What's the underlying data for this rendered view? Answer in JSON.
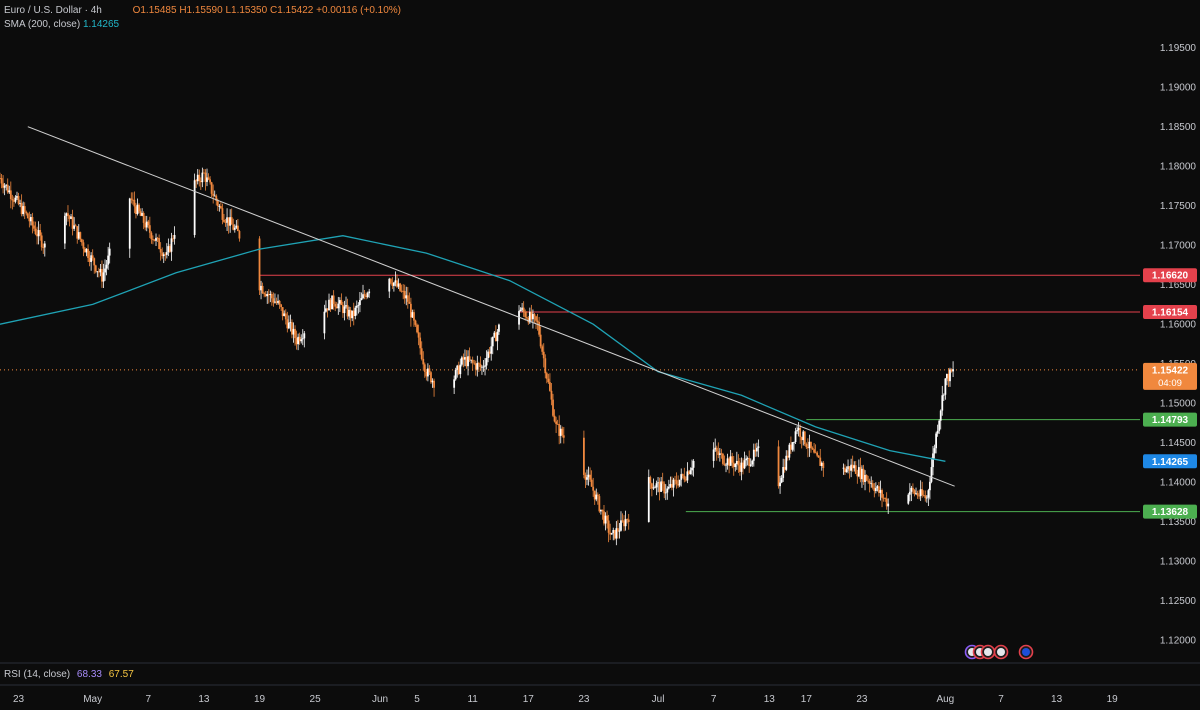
{
  "header": {
    "symbol": "Euro / U.S. Dollar · 4h",
    "open": "O1.15485",
    "high": "H1.15590",
    "low": "L1.15350",
    "close": "C1.15422",
    "change": "+0.00116 (+0.10%)",
    "sma_label": "SMA (200, close)",
    "sma_value": "1.14265"
  },
  "rsi": {
    "label": "RSI (14, close)",
    "value1": "68.33",
    "value2": "67.57"
  },
  "colors": {
    "background": "#0c0c0c",
    "candle": "#f0883e",
    "candle_alt": "#ffffff",
    "sma": "#1fa3b5",
    "trendline": "#d0d0d0",
    "resistance": "#e4414c",
    "support": "#4caf50",
    "current_price": "#f0883e"
  },
  "chart_data": {
    "type": "candlestick",
    "y_axis": {
      "ticks": [
        "1.19500",
        "1.19000",
        "1.18500",
        "1.18000",
        "1.17500",
        "1.17000",
        "1.16500",
        "1.16000",
        "1.15500",
        "1.15000",
        "1.14500",
        "1.14000",
        "1.13500",
        "1.13000",
        "1.12500",
        "1.12000"
      ],
      "range": [
        1.1175,
        1.1985
      ]
    },
    "x_axis": {
      "ticks": [
        "23",
        "May",
        "7",
        "13",
        "19",
        "25",
        "Jun",
        "5",
        "11",
        "17",
        "23",
        "Jul",
        "7",
        "13",
        "17",
        "23",
        "Aug",
        "7",
        "13",
        "19"
      ],
      "range": [
        "2025-04-21",
        "2025-08-22"
      ]
    },
    "path": [
      {
        "x": "2025-04-21",
        "y": 1.1785
      },
      {
        "x": "2025-04-24",
        "y": 1.1735
      },
      {
        "x": "2025-04-26",
        "y": 1.1695
      },
      {
        "x": "2025-04-28",
        "y": 1.1745
      },
      {
        "x": "2025-04-30",
        "y": 1.17
      },
      {
        "x": "2025-05-02",
        "y": 1.166
      },
      {
        "x": "2025-05-05",
        "y": 1.176
      },
      {
        "x": "2025-05-07",
        "y": 1.172
      },
      {
        "x": "2025-05-09",
        "y": 1.1685
      },
      {
        "x": "2025-05-11",
        "y": 1.1765
      },
      {
        "x": "2025-05-13",
        "y": 1.179
      },
      {
        "x": "2025-05-15",
        "y": 1.174
      },
      {
        "x": "2025-05-17",
        "y": 1.171
      },
      {
        "x": "2025-05-19",
        "y": 1.165
      },
      {
        "x": "2025-05-21",
        "y": 1.1625
      },
      {
        "x": "2025-05-23",
        "y": 1.158
      },
      {
        "x": "2025-05-25",
        "y": 1.161
      },
      {
        "x": "2025-05-27",
        "y": 1.163
      },
      {
        "x": "2025-05-29",
        "y": 1.161
      },
      {
        "x": "2025-05-31",
        "y": 1.165
      },
      {
        "x": "2025-06-02",
        "y": 1.166
      },
      {
        "x": "2025-06-04",
        "y": 1.163
      },
      {
        "x": "2025-06-06",
        "y": 1.154
      },
      {
        "x": "2025-06-08",
        "y": 1.151
      },
      {
        "x": "2025-06-10",
        "y": 1.1555
      },
      {
        "x": "2025-06-12",
        "y": 1.1545
      },
      {
        "x": "2025-06-14",
        "y": 1.16
      },
      {
        "x": "2025-06-16",
        "y": 1.162
      },
      {
        "x": "2025-06-18",
        "y": 1.16
      },
      {
        "x": "2025-06-20",
        "y": 1.147
      },
      {
        "x": "2025-06-22",
        "y": 1.144
      },
      {
        "x": "2025-06-24",
        "y": 1.139
      },
      {
        "x": "2025-06-26",
        "y": 1.133
      },
      {
        "x": "2025-06-28",
        "y": 1.136
      },
      {
        "x": "2025-06-30",
        "y": 1.14
      },
      {
        "x": "2025-07-02",
        "y": 1.139
      },
      {
        "x": "2025-07-04",
        "y": 1.141
      },
      {
        "x": "2025-07-06",
        "y": 1.145
      },
      {
        "x": "2025-07-08",
        "y": 1.143
      },
      {
        "x": "2025-07-10",
        "y": 1.142
      },
      {
        "x": "2025-07-12",
        "y": 1.144
      },
      {
        "x": "2025-07-14",
        "y": 1.14
      },
      {
        "x": "2025-07-16",
        "y": 1.147
      },
      {
        "x": "2025-07-18",
        "y": 1.143
      },
      {
        "x": "2025-07-20",
        "y": 1.141
      },
      {
        "x": "2025-07-22",
        "y": 1.142
      },
      {
        "x": "2025-07-24",
        "y": 1.14
      },
      {
        "x": "2025-07-26",
        "y": 1.137
      },
      {
        "x": "2025-07-28",
        "y": 1.139
      },
      {
        "x": "2025-07-30",
        "y": 1.138
      },
      {
        "x": "2025-07-31",
        "y": 1.146
      },
      {
        "x": "2025-08-01",
        "y": 1.153
      },
      {
        "x": "2025-08-02",
        "y": 1.1542
      }
    ],
    "sma": [
      {
        "x": "2025-04-21",
        "y": 1.16
      },
      {
        "x": "2025-05-01",
        "y": 1.1625
      },
      {
        "x": "2025-05-10",
        "y": 1.1665
      },
      {
        "x": "2025-05-19",
        "y": 1.1695
      },
      {
        "x": "2025-05-28",
        "y": 1.1712
      },
      {
        "x": "2025-06-06",
        "y": 1.169
      },
      {
        "x": "2025-06-15",
        "y": 1.1655
      },
      {
        "x": "2025-06-24",
        "y": 1.16
      },
      {
        "x": "2025-07-01",
        "y": 1.154
      },
      {
        "x": "2025-07-10",
        "y": 1.151
      },
      {
        "x": "2025-07-18",
        "y": 1.147
      },
      {
        "x": "2025-07-26",
        "y": 1.144
      },
      {
        "x": "2025-08-01",
        "y": 1.14265
      }
    ],
    "trendline": [
      {
        "x": "2025-04-24",
        "y": 1.185
      },
      {
        "x": "2025-08-02",
        "y": 1.1395
      }
    ],
    "levels": [
      {
        "value": "1.16620",
        "kind": "resistance",
        "from": "2025-05-19"
      },
      {
        "value": "1.16154",
        "kind": "resistance",
        "from": "2025-06-16"
      },
      {
        "value": "1.14793",
        "kind": "support",
        "from": "2025-07-17"
      },
      {
        "value": "1.13628",
        "kind": "support",
        "from": "2025-07-04"
      }
    ],
    "current_price": {
      "value": "1.15422",
      "countdown": "04:09"
    },
    "sma_axis_label": "1.14265"
  }
}
